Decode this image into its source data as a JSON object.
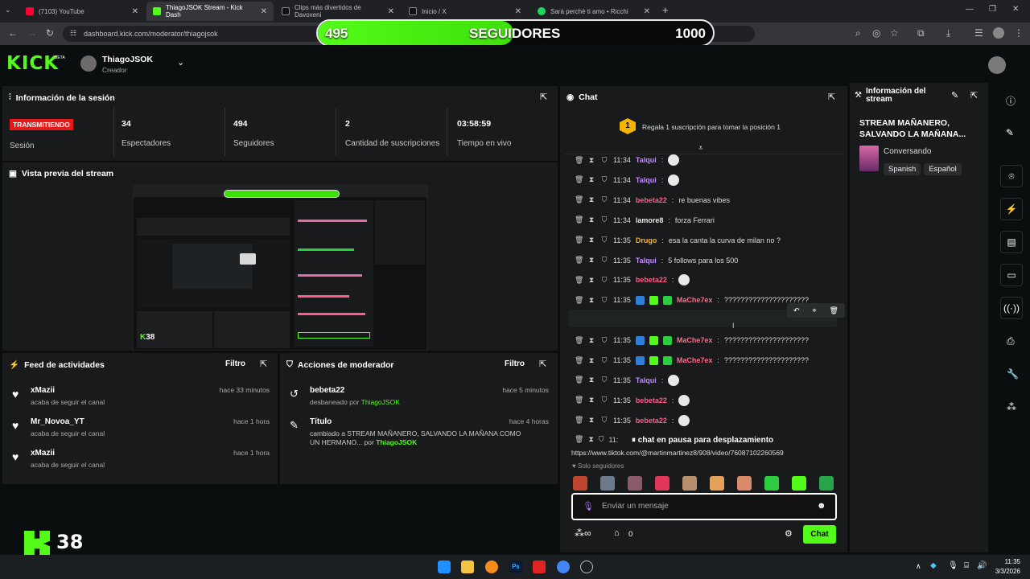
{
  "browser": {
    "tabs": [
      {
        "label": "(7103) YouTube",
        "color": "#ff0033"
      },
      {
        "label": "ThiagoJSOK Stream - Kick Dash",
        "color": "#53fc18"
      },
      {
        "label": "Clips más divertidos de Davoxeni",
        "color": "#000000"
      },
      {
        "label": "Inicio / X",
        "color": "#000000"
      },
      {
        "label": "Sarà perchè ti amo • Ricchi",
        "color": "#1ed760"
      }
    ],
    "url": "dashboard.kick.com/moderator/thiagojsok"
  },
  "goal": {
    "current": "495",
    "label": "SEGUIDORES",
    "target": "1000",
    "progress": 0.495
  },
  "header": {
    "logo": "KICK",
    "beta": "BETA",
    "user": "ThiagoJSOK",
    "role": "Creador"
  },
  "session": {
    "title": "Información de la sesión",
    "live_badge": "TRANSMITIENDO",
    "session_label": "Sesión",
    "stats": [
      {
        "value": "34",
        "label": "Espectadores"
      },
      {
        "value": "494",
        "label": "Seguidores"
      },
      {
        "value": "2",
        "label": "Cantidad de suscripciones"
      },
      {
        "value": "03:58:59",
        "label": "Tiempo en vivo"
      }
    ]
  },
  "preview": {
    "title": "Vista previa del stream",
    "number": "38"
  },
  "feed": {
    "title": "Feed de actividades",
    "filter": "Filtro",
    "items": [
      {
        "name": "xMazii",
        "sub": "acaba de seguir el canal",
        "time": "hace 33 minutos"
      },
      {
        "name": "Mr_Novoa_YT",
        "sub": "acaba de seguir el canal",
        "time": "hace 1 hora"
      },
      {
        "name": "xMazii",
        "sub": "acaba de seguir el canal",
        "time": "hace 1 hora"
      }
    ]
  },
  "modactions": {
    "title": "Acciones de moderador",
    "filter": "Filtro",
    "items": [
      {
        "name": "bebeta22",
        "sub": "desbaneado por",
        "by": "ThiagoJSOK",
        "time": "hace 5 minutos"
      },
      {
        "name": "Título",
        "sub": "cambiado a STREAM MAÑANERO, SALVANDO LA MAÑANA COMO UN HERMANO... por",
        "by": "ThiagoJSOK",
        "time": "hace 4 horas"
      }
    ]
  },
  "chat": {
    "title": "Chat",
    "rank": "1",
    "promo": "Regala 1 suscripción para tomar la posición 1",
    "messages": [
      {
        "time": "11:34",
        "user": "Talqui",
        "color": "#c18cff",
        "text": ""
      },
      {
        "time": "11:34",
        "user": "Talqui",
        "color": "#c18cff",
        "text": ""
      },
      {
        "time": "11:34",
        "user": "bebeta22",
        "color": "#ff5c8a",
        "text": "re buenas vibes"
      },
      {
        "time": "11:34",
        "user": "lamore8",
        "color": "#e6e6e6",
        "text": "forza Ferrari"
      },
      {
        "time": "11:35",
        "user": "Drugo",
        "color": "#ffb020",
        "text": "esa la canta la curva de milan no ?"
      },
      {
        "time": "11:35",
        "user": "Talqui",
        "color": "#c18cff",
        "text": "5 follows para los 500"
      },
      {
        "time": "11:35",
        "user": "bebeta22",
        "color": "#ff5c8a",
        "text": ""
      },
      {
        "time": "11:35",
        "user": "MaChe7ex",
        "color": "#ff6b8b",
        "text": "?????????????????????"
      },
      {
        "time": "11:35",
        "user": "MaChe7ex",
        "color": "#ff6b8b",
        "text": "?????????????????????"
      },
      {
        "time": "11:35",
        "user": "MaChe7ex",
        "color": "#ff6b8b",
        "text": "?????????????????????"
      },
      {
        "time": "11:35",
        "user": "MaChe7ex",
        "color": "#ff6b8b",
        "text": "?????????????????????"
      },
      {
        "time": "11:35",
        "user": "Talqui",
        "color": "#c18cff",
        "text": ""
      },
      {
        "time": "11:35",
        "user": "bebeta22",
        "color": "#ff5c8a",
        "text": ""
      },
      {
        "time": "11:35",
        "user": "bebeta22",
        "color": "#ff5c8a",
        "text": ""
      }
    ],
    "last_time": "11:",
    "paused": "chat en pausa para desplazamiento",
    "link": "https://www.tiktok.com/@martinmartinez8/908/video/76087102260569",
    "followers_only": "Solo seguidores",
    "placeholder": "Enviar un mensaje",
    "count": "0",
    "send": "Chat"
  },
  "streaminfo": {
    "title": "Información del stream",
    "stream_title": "STREAM MAÑANERO, SALVANDO LA MAÑANA...",
    "category": "Conversando",
    "tags": [
      "Spanish",
      "Español"
    ]
  },
  "taskbar": {
    "time": "11:35",
    "date": "3/3/2026"
  },
  "brand_green": "#53fc18"
}
